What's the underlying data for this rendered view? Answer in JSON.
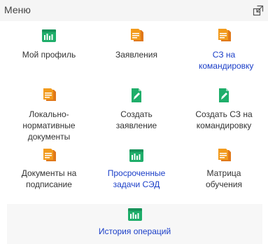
{
  "header": {
    "title": "Меню",
    "expand_icon": "expand-window-icon"
  },
  "menu": {
    "items": [
      {
        "label": "Мой профиль",
        "icon": "chart-report-icon",
        "link": false
      },
      {
        "label": "Заявления",
        "icon": "documents-stack-icon",
        "link": false
      },
      {
        "label": "СЗ на командировку",
        "icon": "documents-stack-icon",
        "link": true
      },
      {
        "label": "Локально-нормативные документы",
        "icon": "documents-stack-icon",
        "link": false
      },
      {
        "label": "Создать заявление",
        "icon": "edit-document-icon",
        "link": false
      },
      {
        "label": "Создать СЗ на командировку",
        "icon": "edit-document-icon",
        "link": false
      },
      {
        "label": "Документы на подписание",
        "icon": "documents-stack-icon",
        "link": false
      },
      {
        "label": "Просроченные задачи СЭД",
        "icon": "chart-report-icon",
        "link": true
      },
      {
        "label": "Матрица обучения",
        "icon": "documents-stack-icon",
        "link": false
      }
    ],
    "history": {
      "label": "История операций",
      "icon": "chart-report-icon"
    }
  },
  "colors": {
    "green": "#1fae6a",
    "orange": "#f29b1d",
    "link": "#1a3ec8"
  }
}
